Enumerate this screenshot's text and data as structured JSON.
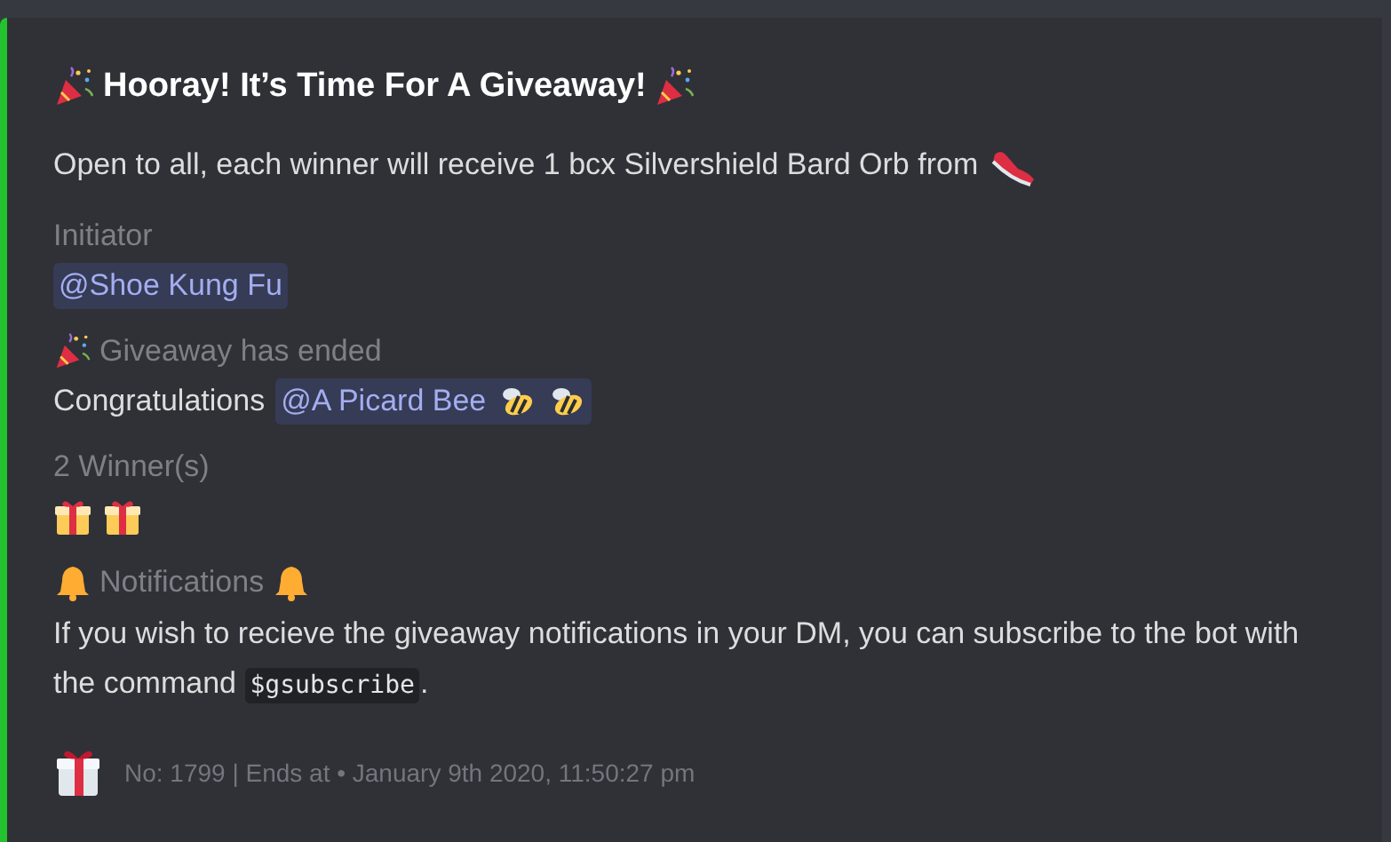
{
  "embed": {
    "title": "Hooray! It’s Time For A Giveaway!",
    "description": "Open to all, each winner will receive 1 bcx Silvershield Bard Orb from",
    "fields": [
      {
        "kind": "mention",
        "name": "Initiator",
        "mention": "@Shoe Kung Fu"
      },
      {
        "kind": "ended",
        "name": "Giveaway has ended",
        "text": "Congratulations",
        "mention": "@A Picard Bee"
      },
      {
        "kind": "winners",
        "name": "2 Winner(s)"
      },
      {
        "kind": "notice",
        "name": "Notifications",
        "text_before": "If you wish to recieve the giveaway notifications in your DM, you can subscribe to the bot with the command",
        "code": "$gsubscribe",
        "text_after": "."
      }
    ],
    "footer": "No: 1799 | Ends at • January 9th 2020, 11:50:27 pm"
  }
}
